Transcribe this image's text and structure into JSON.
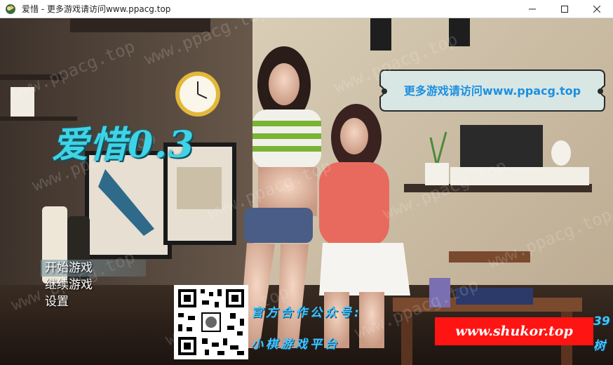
{
  "window": {
    "title": "爱惜 - 更多游戏请访问www.ppacg.top",
    "icon": "game-app-icon",
    "controls": [
      "minimize-icon",
      "maximize-icon",
      "close-icon"
    ]
  },
  "game": {
    "title": "爱惜0.3",
    "banner_text": "更多游戏请访问www.ppacg.top",
    "menu": [
      {
        "label": "开始游戏",
        "selected": true
      },
      {
        "label": "继续游戏",
        "selected": false
      },
      {
        "label": "设置",
        "selected": false
      }
    ]
  },
  "promo": {
    "line1": "官方合作公众号:",
    "line2": "小棋游戏平台",
    "fragment_right": "39",
    "fragment_right2": "树",
    "shukor_label": "www.shukor.top"
  },
  "watermark_text": "www.ppacg.top",
  "colors": {
    "title_cyan": "#3fd3e6",
    "banner_blue": "#1c8fe0",
    "promo_blue": "#43c6ff",
    "shukor_red": "#ff1414"
  }
}
